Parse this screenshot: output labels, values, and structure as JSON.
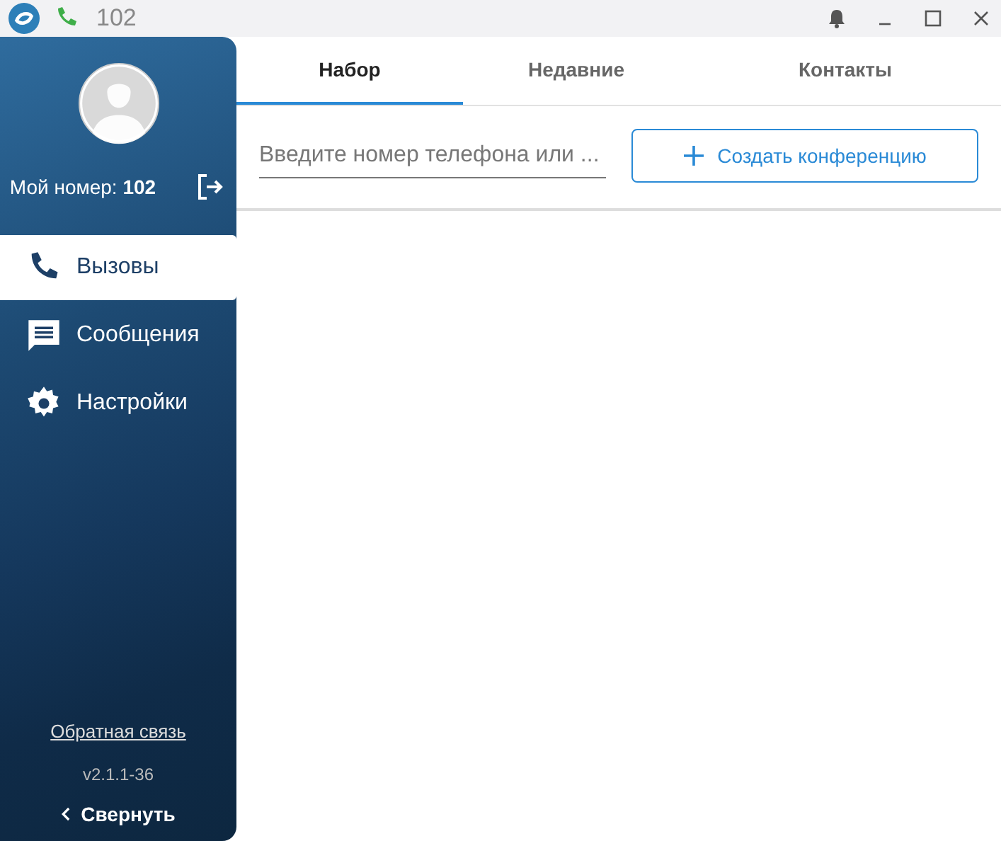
{
  "window": {
    "title": "102"
  },
  "sidebar": {
    "my_number_label": "Мой номер:",
    "my_number": "102",
    "items": [
      {
        "kind": "phone",
        "label": "Вызовы",
        "selected": true
      },
      {
        "kind": "chat",
        "label": "Сообщения",
        "selected": false
      },
      {
        "kind": "gear",
        "label": "Настройки",
        "selected": false
      }
    ],
    "feedback_link": "Обратная связь",
    "version": "v2.1.1-36",
    "collapse": "Свернуть"
  },
  "tabs": [
    {
      "label": "Набор",
      "selected": true
    },
    {
      "label": "Недавние",
      "selected": false
    },
    {
      "label": "Контакты",
      "selected": false
    }
  ],
  "search": {
    "placeholder": "Введите номер телефона или ..."
  },
  "conference_button": "Создать конференцию"
}
